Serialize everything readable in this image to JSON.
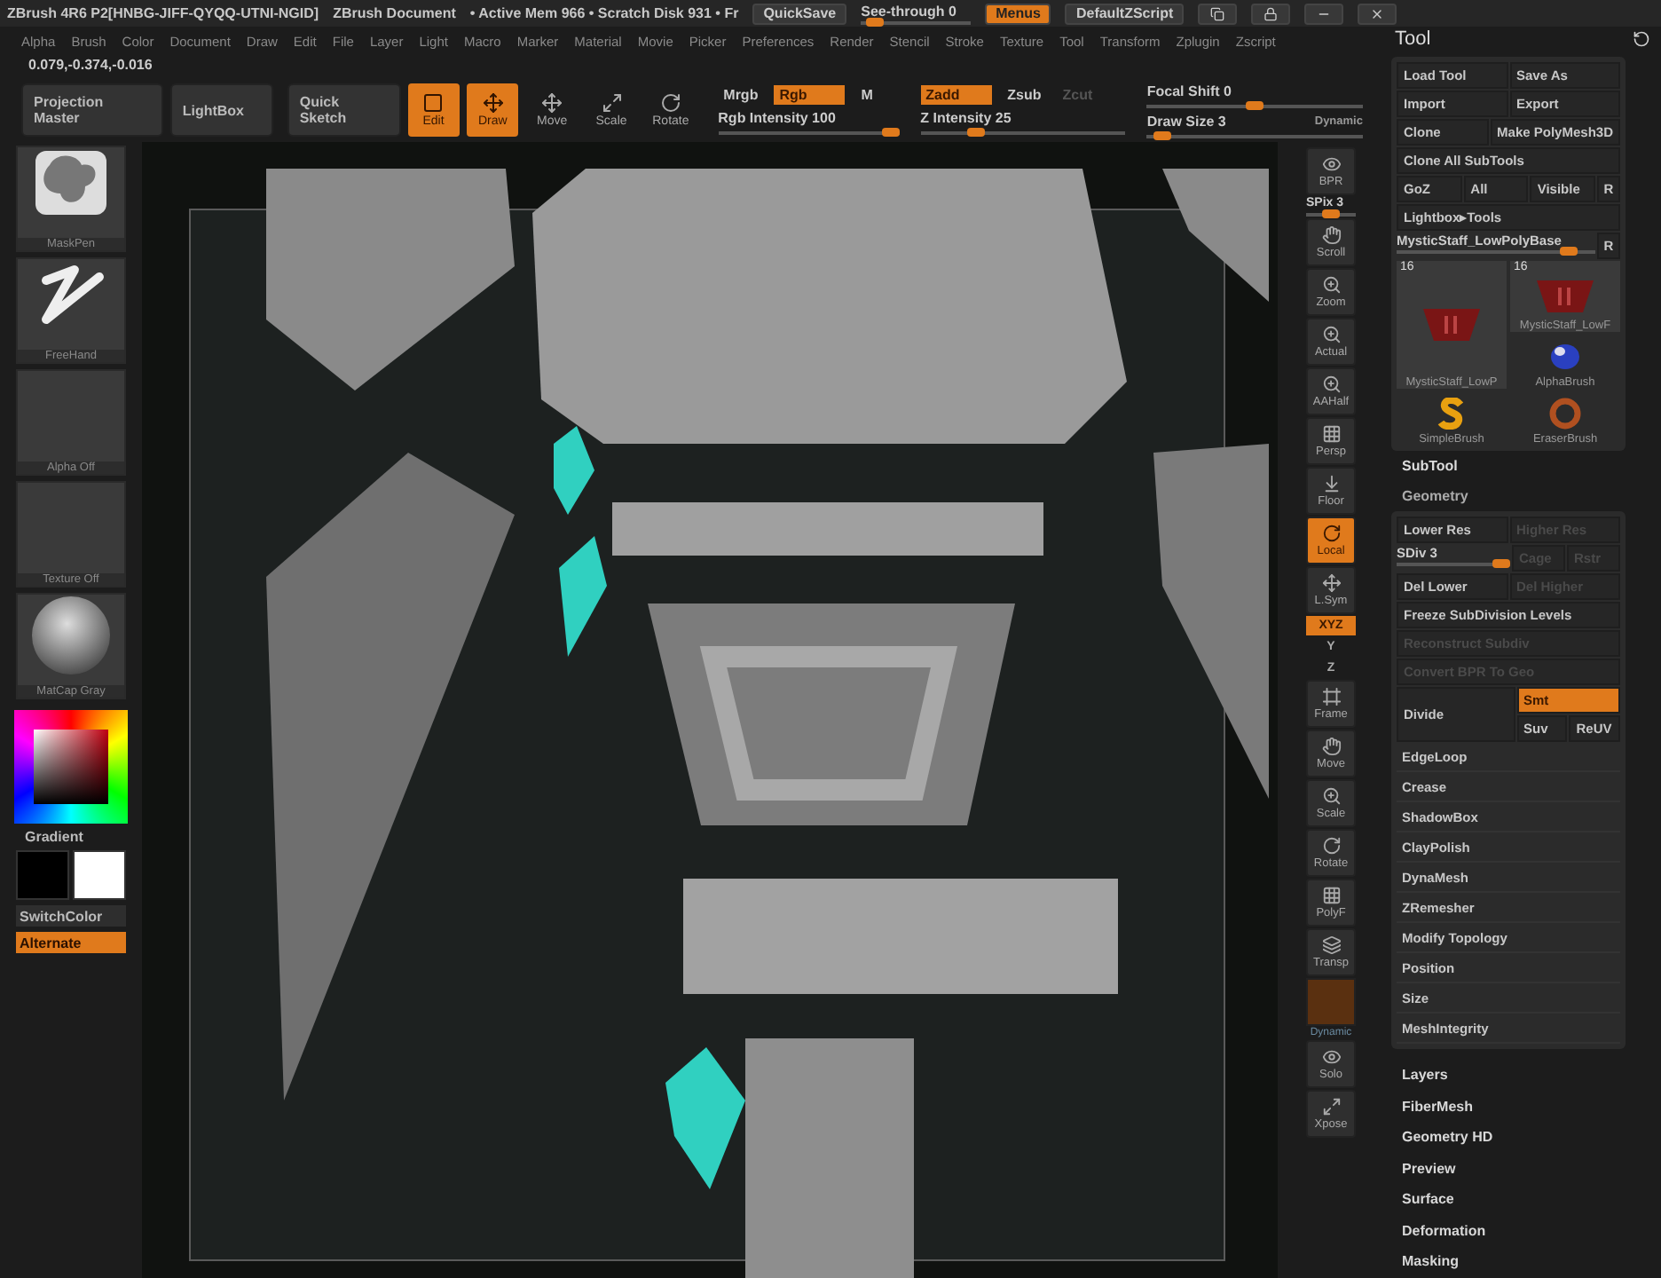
{
  "title_bar": {
    "title": "ZBrush 4R6 P2[HNBG-JIFF-QYQQ-UTNI-NGID]",
    "document": "ZBrush Document",
    "status": "• Active Mem 966 • Scratch Disk 931 • Fr",
    "quicksave": "QuickSave",
    "see_through": {
      "label": "See-through  0",
      "level": 0.05
    },
    "menus": {
      "label": "Menus",
      "on": true
    },
    "script": "DefaultZScript"
  },
  "menu_bar": [
    "Alpha",
    "Brush",
    "Color",
    "Document",
    "Draw",
    "Edit",
    "File",
    "Layer",
    "Light",
    "Macro",
    "Marker",
    "Material",
    "Movie",
    "Picker",
    "Preferences",
    "Render",
    "Stencil",
    "Stroke",
    "Texture",
    "Tool",
    "Transform",
    "Zplugin",
    "Zscript"
  ],
  "coordinates": "0.079,-0.374,-0.016",
  "toolbar": {
    "buttons": [
      "Projection Master",
      "LightBox",
      "Quick Sketch"
    ],
    "modes": [
      {
        "label": "Edit",
        "on": true
      },
      {
        "label": "Draw",
        "on": true
      },
      {
        "label": "Move",
        "on": false
      },
      {
        "label": "Scale",
        "on": false
      },
      {
        "label": "Rotate",
        "on": false
      }
    ],
    "color_modes": [
      {
        "label": "Mrgb",
        "on": false
      },
      {
        "label": "Rgb",
        "on": true
      },
      {
        "label": "M",
        "on": false
      }
    ],
    "rgb_intensity": {
      "label": "Rgb Intensity 100",
      "level": 1
    },
    "z_modes": [
      {
        "label": "Zadd",
        "on": true,
        "disabled": false
      },
      {
        "label": "Zsub",
        "on": false,
        "disabled": false
      },
      {
        "label": "Zcut",
        "on": false,
        "disabled": true
      }
    ],
    "z_intensity": {
      "label": "Z Intensity 25",
      "level": 0.25
    },
    "focal_shift": {
      "label": "Focal Shift 0",
      "level": 0.5
    },
    "draw_size": {
      "label": "Draw Size 3",
      "level": 0.03
    },
    "dynamic": "Dynamic"
  },
  "left_panel": {
    "thumbnails": [
      {
        "label": "MaskPen",
        "kind": "brush"
      },
      {
        "label": "FreeHand",
        "kind": "stroke"
      },
      {
        "label": "Alpha Off",
        "kind": "empty"
      },
      {
        "label": "Texture Off",
        "kind": "empty"
      },
      {
        "label": "MatCap Gray",
        "kind": "sphere"
      }
    ],
    "gradient": "Gradient",
    "switch_color": "SwitchColor",
    "alternate": {
      "label": "Alternate",
      "on": true
    }
  },
  "shelf": [
    {
      "label": "BPR",
      "kind": "button",
      "on": false
    },
    {
      "label": "SPix 3",
      "kind": "slider",
      "level": 0.5
    },
    {
      "label": "Scroll",
      "kind": "button",
      "on": false
    },
    {
      "label": "Zoom",
      "kind": "button",
      "on": false
    },
    {
      "label": "Actual",
      "kind": "button",
      "on": false
    },
    {
      "label": "AAHalf",
      "kind": "button",
      "on": false
    },
    {
      "label": "Persp",
      "kind": "button",
      "on": false
    },
    {
      "label": "Floor",
      "kind": "button",
      "on": false
    },
    {
      "label": "Local",
      "kind": "button",
      "on": true
    },
    {
      "label": "L.Sym",
      "kind": "button",
      "on": false
    },
    {
      "label": "XYZ",
      "kind": "toggle",
      "on": true
    },
    {
      "label": "Y",
      "kind": "toggle",
      "on": false
    },
    {
      "label": "Z",
      "kind": "toggle",
      "on": false
    },
    {
      "label": "Frame",
      "kind": "button",
      "on": false
    },
    {
      "label": "Move",
      "kind": "button",
      "on": false
    },
    {
      "label": "Scale",
      "kind": "button",
      "on": false
    },
    {
      "label": "Rotate",
      "kind": "button",
      "on": false
    },
    {
      "label": "PolyF",
      "kind": "button",
      "on": false
    },
    {
      "label": "Transp",
      "kind": "button",
      "on": false
    },
    {
      "kind": "swatch"
    },
    {
      "label": "Dynamic",
      "kind": "caption"
    },
    {
      "label": "Solo",
      "kind": "button",
      "on": false
    },
    {
      "label": "Xpose",
      "kind": "button",
      "on": false
    }
  ],
  "tool_panel": {
    "title": "Tool",
    "rows": [
      [
        {
          "label": "Load Tool"
        },
        {
          "label": "Save As"
        }
      ],
      [
        {
          "label": "Import"
        },
        {
          "label": "Export"
        }
      ],
      [
        {
          "label": "Clone"
        },
        {
          "label": "Make PolyMesh3D"
        }
      ],
      [
        {
          "label": "Clone All SubTools"
        }
      ],
      [
        {
          "label": "GoZ"
        },
        {
          "label": "All"
        },
        {
          "label": "Visible"
        },
        {
          "label": "R"
        }
      ],
      [
        {
          "label": "Lightbox▸Tools"
        }
      ]
    ],
    "current_tool": {
      "label": "MysticStaff_LowPolyBase",
      "level": 0.9,
      "reset": "R"
    },
    "tools": [
      {
        "label": "MysticStaff_LowP",
        "count": "16",
        "kind": "mesh"
      },
      {
        "label": "MysticStaff_LowF",
        "count": "16",
        "kind": "mesh"
      },
      {
        "label": "AlphaBrush",
        "kind": "alpha"
      },
      {
        "label": "SimpleBrush",
        "kind": "simple"
      },
      {
        "label": "EraserBrush",
        "kind": "eraser"
      }
    ],
    "subtool": "SubTool",
    "geometry": {
      "title": "Geometry",
      "res_row": [
        {
          "label": "Lower Res",
          "disabled": false
        },
        {
          "label": "Higher Res",
          "disabled": true
        }
      ],
      "sdiv": {
        "label": "SDiv 3",
        "level": 1
      },
      "sdiv_buttons": [
        {
          "label": "Cage",
          "disabled": true
        },
        {
          "label": "Rstr",
          "disabled": true
        }
      ],
      "del_row": [
        {
          "label": "Del Lower",
          "disabled": false
        },
        {
          "label": "Del Higher",
          "disabled": true
        }
      ],
      "wide": [
        {
          "label": "Freeze SubDivision Levels",
          "disabled": false
        },
        {
          "label": "Reconstruct Subdiv",
          "disabled": true
        },
        {
          "label": "Convert BPR To Geo",
          "disabled": true
        }
      ],
      "divide": {
        "label": "Divide",
        "smt": {
          "label": "Smt",
          "on": true
        },
        "suv": {
          "label": "Suv",
          "on": false
        },
        "reuv": "ReUV"
      },
      "sections": [
        "EdgeLoop",
        "Crease",
        "ShadowBox",
        "ClayPolish",
        "DynaMesh",
        "ZRemesher",
        "Modify Topology",
        "Position",
        "Size",
        "MeshIntegrity"
      ]
    },
    "sections": [
      "Layers",
      "FiberMesh",
      "Geometry HD",
      "Preview",
      "Surface",
      "Deformation",
      "Masking"
    ]
  }
}
